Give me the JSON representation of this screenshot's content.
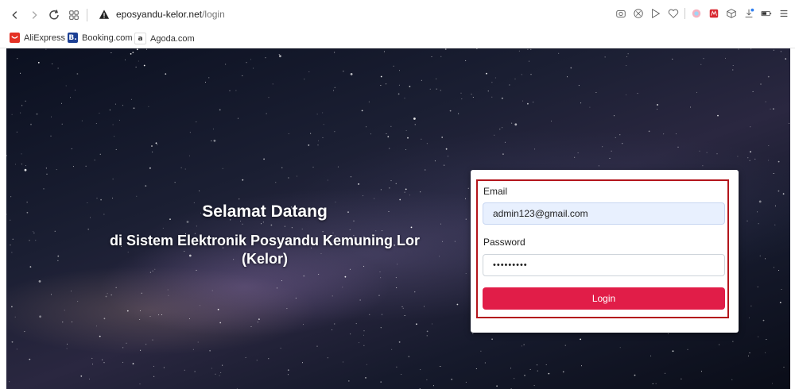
{
  "browser": {
    "url_host": "eposyandu-kelor.net",
    "url_path": "/login",
    "bookmarks": [
      {
        "label": "AliExpress",
        "icon": "aliexpress-icon",
        "color": "#e43225",
        "glyph": ""
      },
      {
        "label": "Booking.com",
        "icon": "booking-icon",
        "color": "#1c3f94",
        "glyph": "B."
      },
      {
        "label": "Agoda.com",
        "icon": "agoda-icon",
        "color": "#ffffff",
        "glyph": "a"
      }
    ]
  },
  "welcome": {
    "title": "Selamat Datang",
    "line1": "di Sistem Elektronik Posyandu Kemuning Lor",
    "line2": "(Kelor)"
  },
  "login": {
    "email_label": "Email",
    "email_value": "admin123@gmail.com",
    "password_label": "Password",
    "password_value": "•••••••••",
    "button_label": "Login",
    "accent_color": "#e11d48",
    "highlight_color": "#b3151b"
  }
}
